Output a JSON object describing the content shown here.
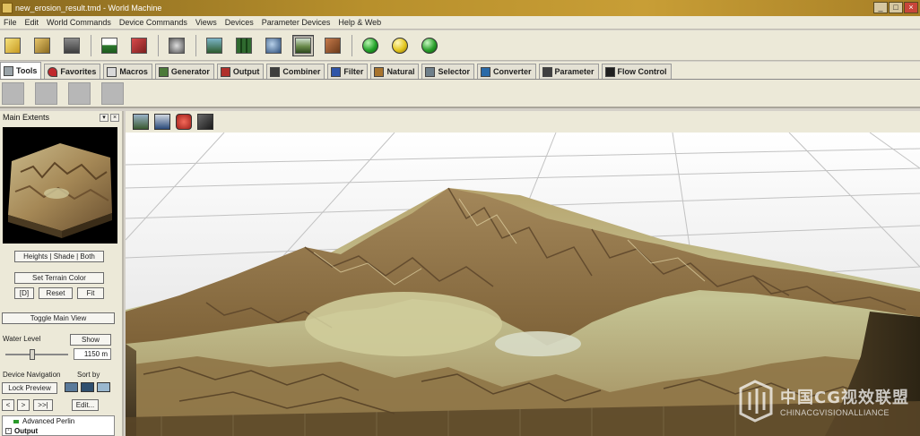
{
  "window": {
    "title": "new_erosion_result.tmd - World Machine",
    "controls": [
      "_",
      "□",
      "×"
    ]
  },
  "menu": [
    "File",
    "Edit",
    "World Commands",
    "Device Commands",
    "Views",
    "Devices",
    "Parameter Devices",
    "Help & Web"
  ],
  "toolbar": {
    "buttons": [
      "new-file-icon",
      "open-folder-icon",
      "save-icon",
      "world-settings-icon",
      "render-icon",
      "explorer-icon",
      "layout-view-icon",
      "grid-view-icon",
      "terrain-view-icon",
      "3d-view-icon",
      "texture-view-icon"
    ],
    "orbs": [
      {
        "name": "build-green-orb",
        "color": "#25a32a"
      },
      {
        "name": "build-yellow-orb",
        "color": "#e3c61e"
      },
      {
        "name": "build-add-orb",
        "color": "#2a9f2a"
      }
    ]
  },
  "tabs": [
    "Tools",
    "Favorites",
    "Macros",
    "Generator",
    "Output",
    "Combiner",
    "Filter",
    "Natural",
    "Selector",
    "Converter",
    "Parameter",
    "Flow Control"
  ],
  "left_panel": {
    "title": "Main Extents",
    "view_modes": "Heights | Shade | Both",
    "set_terrain_color": "Set Terrain Color",
    "btn_d": "[D]",
    "btn_reset": "Reset",
    "btn_fit": "Fit",
    "toggle_main_view": "Toggle Main View",
    "water_level_label": "Water Level",
    "show_label": "Show",
    "water_value": "1150 m",
    "device_navigation": "Device Navigation",
    "sort_by": "Sort by",
    "lock_preview": "Lock Preview",
    "nav_prev": "<",
    "nav_next": ">",
    "nav_last": ">>|",
    "edit": "Edit...",
    "tree": [
      {
        "label": "Advanced Perlin"
      },
      {
        "label": "Output"
      }
    ]
  },
  "viewport": {
    "toolbar_icons": [
      "view-terrain-icon",
      "view-height-icon",
      "render-stop-icon",
      "texture-cube-icon"
    ]
  },
  "watermark": {
    "cn": "中国CG视效联盟",
    "en": "CHINACGVISIONALLIANCE"
  },
  "colors": {
    "title_bar": "#b8902c",
    "menu_bg": "#ece9d8",
    "terrain_light": "#c4c493",
    "terrain_dark": "#6a4e2c"
  }
}
